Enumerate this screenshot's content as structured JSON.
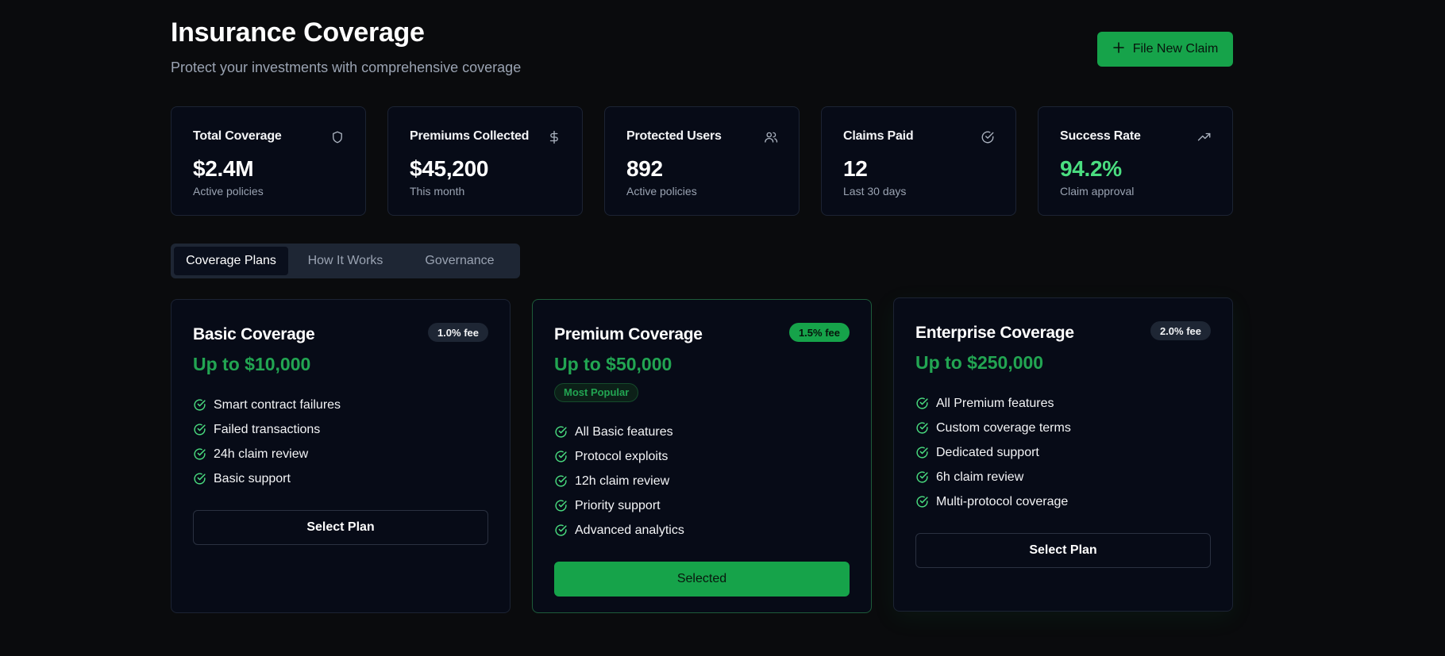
{
  "header": {
    "title": "Insurance Coverage",
    "subtitle": "Protect your investments with comprehensive coverage",
    "claim_button": "File New Claim",
    "claim_icon": "plus-icon"
  },
  "stats": [
    {
      "label": "Total Coverage",
      "value": "$2.4M",
      "sub": "Active policies",
      "icon": "shield-icon"
    },
    {
      "label": "Premiums Collected",
      "value": "$45,200",
      "sub": "This month",
      "icon": "dollar-icon"
    },
    {
      "label": "Protected Users",
      "value": "892",
      "sub": "Active policies",
      "icon": "users-icon"
    },
    {
      "label": "Claims Paid",
      "value": "12",
      "sub": "Last 30 days",
      "icon": "check-circle-icon"
    },
    {
      "label": "Success Rate",
      "value": "94.2%",
      "sub": "Claim approval",
      "icon": "trending-up-icon",
      "value_color": "#4ade80"
    }
  ],
  "tabs": [
    {
      "label": "Coverage Plans",
      "active": true
    },
    {
      "label": "How It Works",
      "active": false
    },
    {
      "label": "Governance",
      "active": false
    }
  ],
  "plans": [
    {
      "name": "Basic Coverage",
      "fee": "1.0% fee",
      "amount": "Up to $10,000",
      "features": [
        "Smart contract failures",
        "Failed transactions",
        "24h claim review",
        "Basic support"
      ],
      "button": "Select Plan"
    },
    {
      "name": "Premium Coverage",
      "fee": "1.5% fee",
      "amount": "Up to $50,000",
      "badge": "Most Popular",
      "features": [
        "All Basic features",
        "Protocol exploits",
        "12h claim review",
        "Priority support",
        "Advanced analytics"
      ],
      "button": "Selected",
      "selected": true
    },
    {
      "name": "Enterprise Coverage",
      "fee": "2.0% fee",
      "amount": "Up to $250,000",
      "features": [
        "All Premium features",
        "Custom coverage terms",
        "Dedicated support",
        "6h claim review",
        "Multi-protocol coverage"
      ],
      "button": "Select Plan"
    }
  ],
  "colors": {
    "background": "#0a0b0d",
    "card": "#070b17",
    "accent": "#16a34a",
    "accent_text": "#22a552",
    "success": "#4ade80"
  }
}
